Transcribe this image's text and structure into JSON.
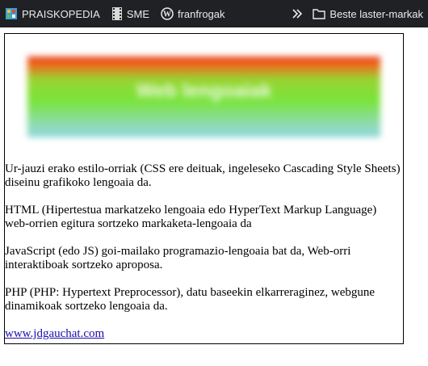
{
  "bookmarks": {
    "items": [
      {
        "label": "PRAISKOPEDIA",
        "icon": "praiskopedia-icon"
      },
      {
        "label": "SME",
        "icon": "film-strip-icon"
      },
      {
        "label": "franfrogak",
        "icon": "wordpress-icon"
      }
    ],
    "overflow_icon": "double-chevron-icon",
    "folder": {
      "label": "Beste laster-markak",
      "icon": "folder-icon"
    }
  },
  "page": {
    "banner_text": "Web lengoaiak",
    "paragraphs": [
      "Ur-jauzi erako estilo-orriak (CSS ere deituak, ingeleseko Cascading Style Sheets) diseinu grafikoko lengoaia da.",
      "HTML (Hipertestua markatzeko lengoaia edo HyperText Markup Language) web-orrien egitura sortzeko markaketa-lengoaia da",
      "JavaScript (edo JS) goi-mailako programazio-lengoaia bat da, Web-orri interaktiboak sortzeko aproposa.",
      "PHP (PHP: Hypertext Preprocessor), datu baseekin elkarreraginez, webgune dinamikoak sortzeko lengoaia da."
    ],
    "link": "www.jdgauchat.com"
  },
  "colors": {
    "toolbar_bg": "#202124",
    "toolbar_text": "#e8eaed",
    "link": "#1a0dab"
  }
}
